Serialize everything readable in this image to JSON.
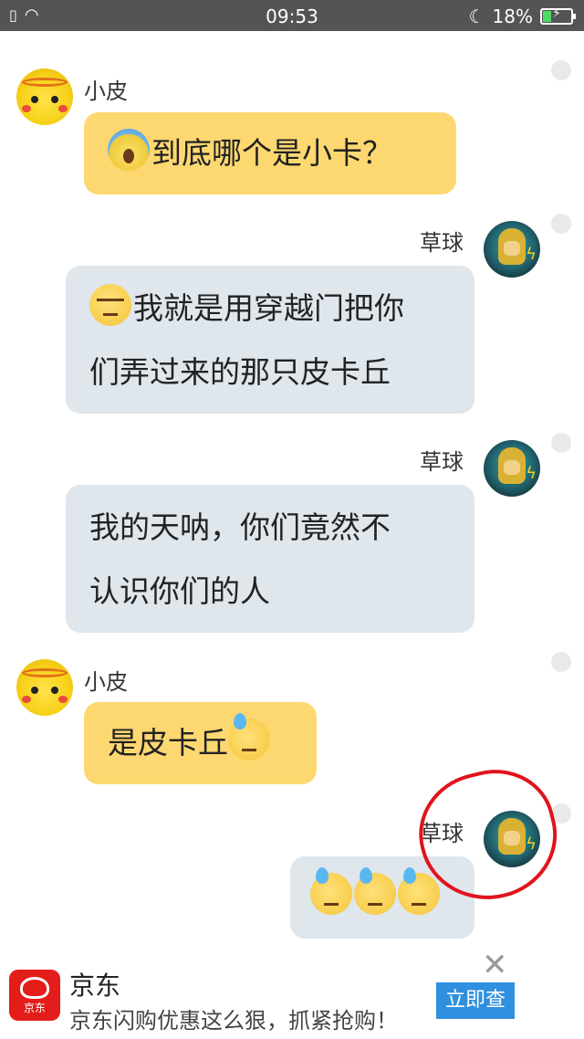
{
  "status_bar": {
    "time": "09:53",
    "battery": "18%"
  },
  "messages": [
    {
      "sender": "小皮",
      "text": "到底哪个是小卡？",
      "emoji": "scream"
    },
    {
      "sender": "草球",
      "line1": "我就是用穿越门把你",
      "line2": "们弄过来的那只皮卡丘",
      "emoji": "unamused"
    },
    {
      "sender": "草球",
      "line1": "我的天呐，你们竟然不",
      "line2": "认识你们的人"
    },
    {
      "sender": "小皮",
      "text": "是皮卡丘",
      "emoji": "sweat"
    },
    {
      "sender": "草球",
      "emoji": "sweat x3"
    }
  ],
  "ad": {
    "logo_text": "京东",
    "title": "京东",
    "desc": "京东闪购优惠这么狠，抓紧抢购！",
    "button": "立即查",
    "close": "✕"
  },
  "colors": {
    "yellow_bubble": "#fdd871",
    "grey_bubble": "#dfe6ec",
    "annotation": "#e0141c"
  }
}
